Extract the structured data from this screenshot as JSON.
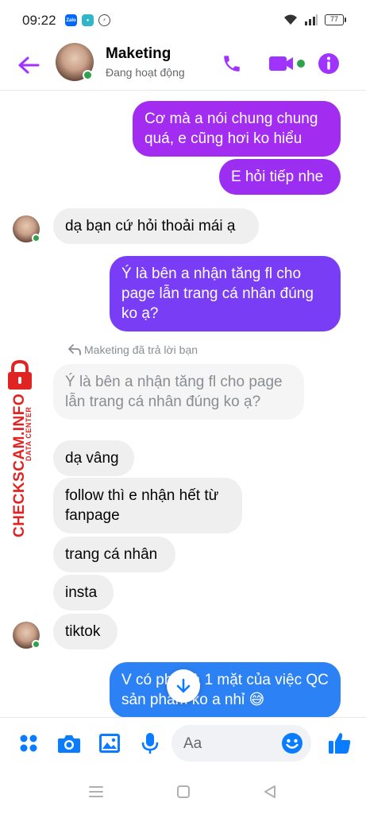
{
  "status_bar": {
    "time": "09:22",
    "battery": "77",
    "apps": [
      "Zalo",
      "Messenger-bubble",
      "Messenger"
    ]
  },
  "header": {
    "name": "Maketing",
    "status": "Đang hoạt động"
  },
  "messages": [
    {
      "side": "out",
      "text": "Cơ mà a nói chung chung quá, e cũng hơi ko hiểu"
    },
    {
      "side": "out",
      "text": "E hỏi tiếp nhe"
    },
    {
      "side": "in",
      "text": "dạ bạn cứ hỏi thoải mái ạ"
    },
    {
      "side": "out",
      "text": "Ý là bên a nhận tăng fl cho page lẫn trang cá nhân đúng ko ạ?"
    },
    {
      "side": "in-quoted",
      "text": "Ý là bên a nhận tăng fl cho page lẫn trang cá nhân đúng ko ạ?"
    },
    {
      "side": "in",
      "text": "dạ vâng"
    },
    {
      "side": "in",
      "text": "follow thì e nhận hết từ fanpage"
    },
    {
      "side": "in",
      "text": "trang cá nhân"
    },
    {
      "side": "in",
      "text": "insta"
    },
    {
      "side": "in",
      "text": "tiktok"
    },
    {
      "side": "out",
      "text": "V có phải là 1 mặt của việc QC sản phẩm ko a nhỉ 😅"
    }
  ],
  "reply_note": "Maketing đã trả lời bạn",
  "watermark": {
    "main": "CHECKSCAM.INFO",
    "sub": "DATA CENTER"
  },
  "composer": {
    "placeholder": "Aa"
  },
  "colors": {
    "accent": "#a033ff",
    "outgoing_top": "#a22cf0",
    "outgoing_mid": "#7a3df6",
    "outgoing_bottom": "#2c82f5",
    "online": "#31a24c"
  },
  "icons": [
    "back-arrow-icon",
    "phone-icon",
    "video-icon",
    "info-icon",
    "menu-dots-icon",
    "camera-icon",
    "gallery-icon",
    "mic-icon",
    "emoji-icon",
    "like-icon",
    "scroll-down-icon"
  ]
}
